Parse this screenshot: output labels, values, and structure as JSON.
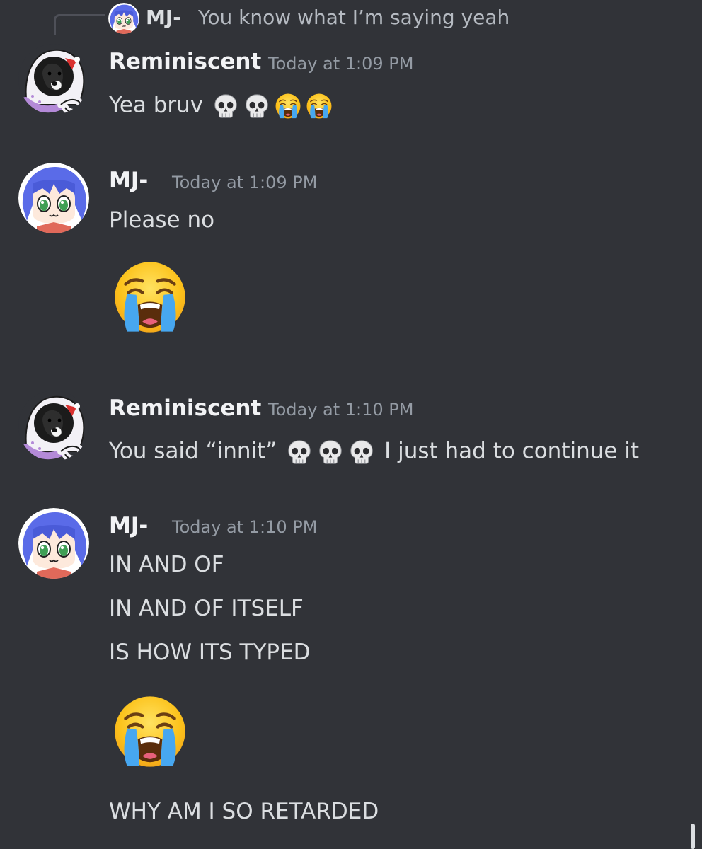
{
  "reply": {
    "author": "MJ-",
    "content": "You know what I’m saying yeah"
  },
  "messages": [
    {
      "author": "Reminiscent",
      "timestamp": "Today at 1:09 PM",
      "avatar": "dog-in-hood-avatar",
      "text": "Yea bruv",
      "inline_emojis": [
        "skull-emoji",
        "skull-emoji",
        "loudly-crying-emoji",
        "loudly-crying-emoji"
      ]
    },
    {
      "author": "MJ-",
      "timestamp": "Today at 1:09 PM",
      "avatar": "anime-girl-avatar",
      "lines": [
        "Please no"
      ],
      "big_emoji": "loudly-crying-emoji"
    },
    {
      "author": "Reminiscent",
      "timestamp": "Today at 1:10 PM",
      "avatar": "dog-in-hood-avatar",
      "text_before": "You said “innit”",
      "inline_emojis": [
        "skull-emoji",
        "skull-emoji",
        "skull-emoji"
      ],
      "text_after": "I just had to continue it"
    },
    {
      "author": "MJ-",
      "timestamp": "Today at 1:10 PM",
      "avatar": "anime-girl-avatar",
      "lines": [
        "IN AND OF",
        "IN AND OF ITSELF",
        "IS HOW ITS TYPED"
      ],
      "big_emoji": "loudly-crying-emoji",
      "last_line": "WHY AM I SO RETARDED"
    }
  ],
  "colors": {
    "background": "#313338",
    "username": "#f2f3f5",
    "message_text": "#dbdee1",
    "timestamp": "#949ba4",
    "reply_line": "#4e5058"
  }
}
